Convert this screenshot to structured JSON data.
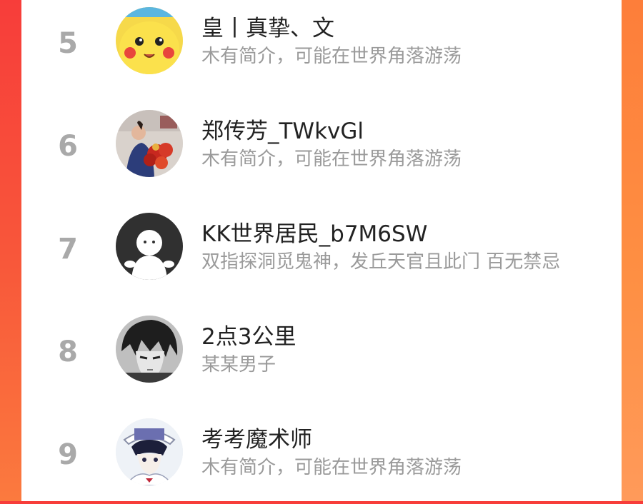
{
  "ranking": {
    "items": [
      {
        "rank": "5",
        "name": "皇丨真挚、文",
        "bio": "木有简介，可能在世界角落游荡",
        "avatar": "pikachu-avatar"
      },
      {
        "rank": "6",
        "name": "郑传芳_TWkvGl",
        "bio": "木有简介，可能在世界角落游荡",
        "avatar": "photo-avatar"
      },
      {
        "rank": "7",
        "name": "KK世界居民_b7M6SW",
        "bio": "双指探洞觅鬼神，发丘天官且此门 百无禁忌",
        "avatar": "default-avatar"
      },
      {
        "rank": "8",
        "name": "2点3公里",
        "bio": "某某男子",
        "avatar": "anime-boy-avatar"
      },
      {
        "rank": "9",
        "name": "考考魔术师",
        "bio": "木有简介，可能在世界角落游荡",
        "avatar": "magician-avatar"
      }
    ]
  },
  "colors": {
    "background_left": "#f73d3a",
    "background_right": "#fd7e3a",
    "rank_gray": "#a9a9a9",
    "name_text": "#222222",
    "bio_text": "#9a9a9a"
  }
}
